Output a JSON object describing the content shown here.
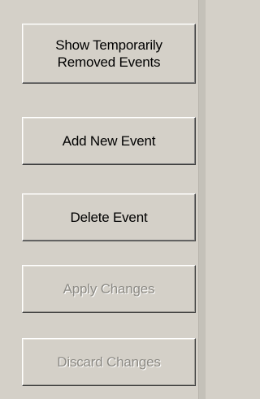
{
  "buttons": {
    "show_removed": {
      "label": "Show Temporarily\nRemoved Events",
      "enabled": true
    },
    "add_event": {
      "label": "Add New Event",
      "enabled": true
    },
    "delete_event": {
      "label": "Delete Event",
      "enabled": true
    },
    "apply_changes": {
      "label": "Apply Changes",
      "enabled": false
    },
    "discard_changes": {
      "label": "Discard Changes",
      "enabled": false
    }
  },
  "colors": {
    "panel_background": "#d4d0c8",
    "text_enabled": "#000000",
    "text_disabled": "#8c8a84"
  }
}
